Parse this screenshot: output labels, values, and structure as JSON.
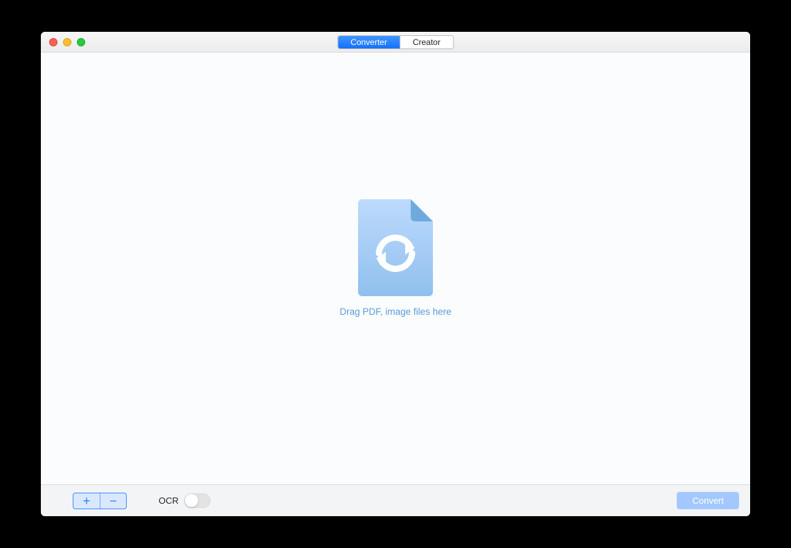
{
  "tabs": {
    "converter": "Converter",
    "creator": "Creator",
    "active": "converter"
  },
  "main": {
    "drop_label": "Drag PDF, image files here"
  },
  "toolbar": {
    "add_tooltip": "+",
    "remove_tooltip": "−",
    "ocr_label": "OCR",
    "ocr_on": false,
    "convert_label": "Convert"
  },
  "colors": {
    "accent": "#2d7bff",
    "drop_text": "#599cdc"
  }
}
